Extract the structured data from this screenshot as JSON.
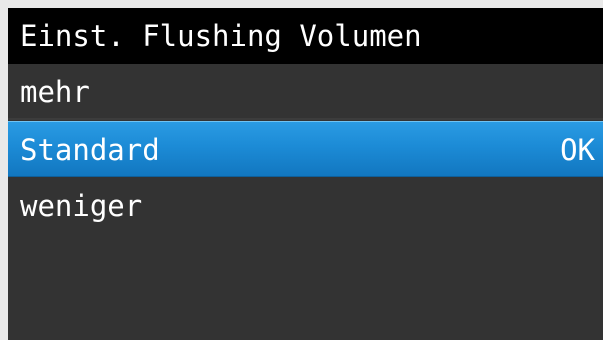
{
  "screen": {
    "title": "Einst. Flushing Volumen",
    "selected_index": 1,
    "ok_label": "OK",
    "items": [
      {
        "label": "mehr"
      },
      {
        "label": "Standard"
      },
      {
        "label": "weniger"
      }
    ]
  },
  "colors": {
    "title_bar": "#000000",
    "background": "#333333",
    "selected_highlight": "#1c8bd6",
    "text": "#ffffff"
  }
}
